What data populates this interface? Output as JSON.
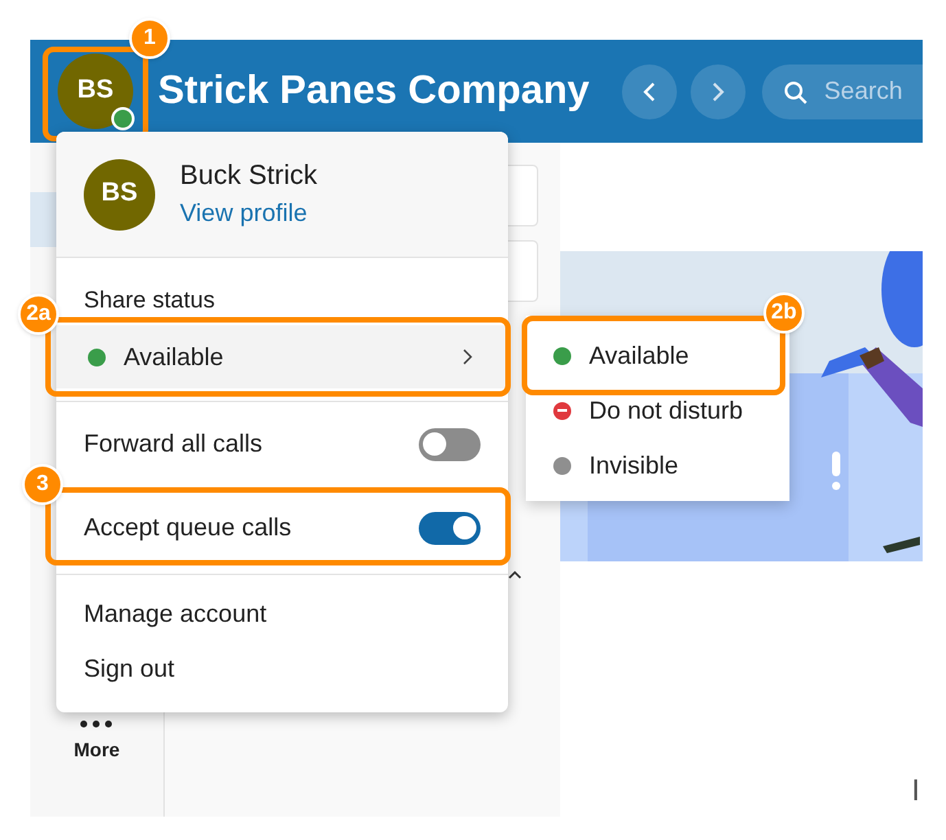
{
  "header": {
    "avatar": {
      "initials": "BS",
      "presence": {
        "color": "#3a9d4a"
      },
      "callout": "1"
    },
    "title": "Strick Panes Company",
    "search": {
      "placeholder": "Search"
    }
  },
  "sidebar": {
    "items": [
      {
        "label": "More"
      }
    ]
  },
  "content": {
    "text_fragment": "I"
  },
  "profile_menu": {
    "avatar_initials": "BS",
    "name": "Buck Strick",
    "link": "View profile",
    "status_heading": "Share status",
    "status": {
      "label": "Available",
      "color": "#3a9d4a",
      "callout": "2a"
    },
    "toggles": [
      {
        "label": "Forward all calls",
        "on": false
      },
      {
        "label": "Accept queue calls",
        "on": true,
        "callout": "3"
      }
    ],
    "actions": [
      "Manage account",
      "Sign out"
    ]
  },
  "status_submenu": {
    "options": [
      {
        "label": "Available",
        "kind": "dot",
        "color": "#3a9d4a",
        "callout": "2b"
      },
      {
        "label": "Do not disturb",
        "kind": "blocked",
        "color": "#e0393e"
      },
      {
        "label": "Invisible",
        "kind": "dot",
        "color": "#8f8f8f"
      }
    ]
  }
}
